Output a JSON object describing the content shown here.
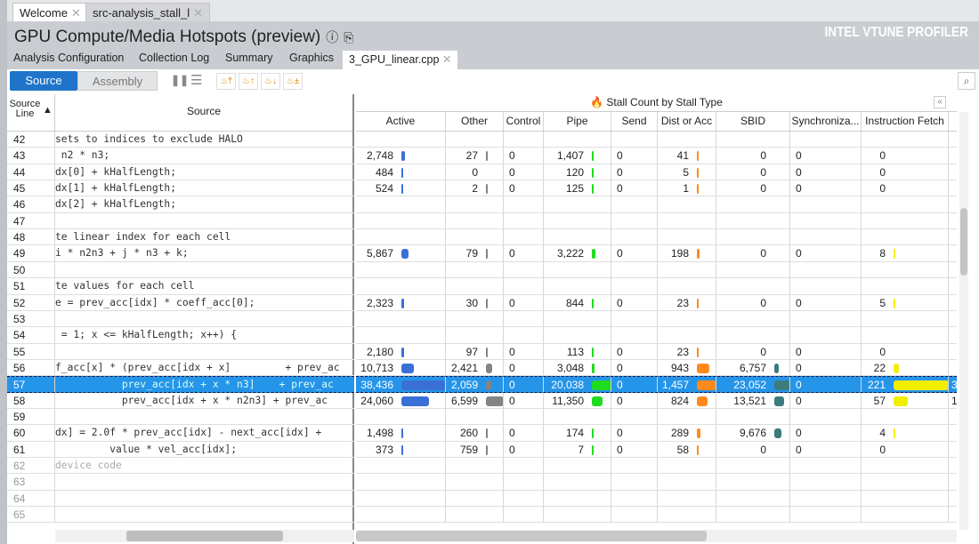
{
  "doc_tabs": [
    {
      "label": "Welcome"
    },
    {
      "label": "src-analysis_stall_l"
    }
  ],
  "title": "GPU Compute/Media Hotspots (preview)",
  "brand": "INTEL VTUNE PROFILER",
  "nav_tabs": [
    "Analysis Configuration",
    "Collection Log",
    "Summary",
    "Graphics",
    "3_GPU_linear.cpp"
  ],
  "toolbar": {
    "source": "Source",
    "assembly": "Assembly"
  },
  "left_headers": {
    "line": "Source Line",
    "source": "Source"
  },
  "group_header": "Stall Count by Stall Type",
  "columns": [
    "Active",
    "Other",
    "Control",
    "Pipe",
    "Send",
    "Dist or Acc",
    "SBID",
    "Synchroniza...",
    "Instruction Fetch"
  ],
  "bar_colors": {
    "0": "#3a70d6",
    "1": "#848484",
    "3": "#1edc1e",
    "5": "#ff8a1c",
    "6": "#3c7c7c",
    "8": "#f2ee00"
  },
  "rows": [
    {
      "line": "42",
      "src": "sets to indices to exclude HALO",
      "v": []
    },
    {
      "line": "43",
      "src": " n2 * n3;",
      "v": [
        "2,748",
        "27",
        "0",
        "1,407",
        "0",
        "41",
        "0",
        "0",
        "0"
      ]
    },
    {
      "line": "44",
      "src": "dx[0] + kHalfLength;",
      "v": [
        "484",
        "0",
        "0",
        "120",
        "0",
        "5",
        "0",
        "0",
        "0"
      ]
    },
    {
      "line": "45",
      "src": "dx[1] + kHalfLength;",
      "v": [
        "524",
        "2",
        "0",
        "125",
        "0",
        "1",
        "0",
        "0",
        "0"
      ]
    },
    {
      "line": "46",
      "src": "dx[2] + kHalfLength;",
      "v": []
    },
    {
      "line": "47",
      "src": "",
      "v": []
    },
    {
      "line": "48",
      "src": "te linear index for each cell",
      "v": []
    },
    {
      "line": "49",
      "src": "i * n2n3 + j * n3 + k;",
      "v": [
        "5,867",
        "79",
        "0",
        "3,222",
        "0",
        "198",
        "0",
        "0",
        "8"
      ]
    },
    {
      "line": "50",
      "src": "",
      "v": []
    },
    {
      "line": "51",
      "src": "te values for each cell",
      "v": []
    },
    {
      "line": "52",
      "src": "e = prev_acc[idx] * coeff_acc[0];",
      "v": [
        "2,323",
        "30",
        "0",
        "844",
        "0",
        "23",
        "0",
        "0",
        "5"
      ]
    },
    {
      "line": "53",
      "src": "",
      "v": []
    },
    {
      "line": "54",
      "src": " = 1; x <= kHalfLength; x++) {",
      "v": []
    },
    {
      "line": "55",
      "src": "",
      "v": [
        "2,180",
        "97",
        "0",
        "113",
        "0",
        "23",
        "0",
        "0",
        "0"
      ]
    },
    {
      "line": "56",
      "src": "f_acc[x] * (prev_acc[idx + x]         + prev_ac",
      "v": [
        "10,713",
        "2,421",
        "0",
        "3,048",
        "0",
        "943",
        "6,757",
        "0",
        "22"
      ]
    },
    {
      "line": "57",
      "src": "           prev_acc[idx + x * n3]    + prev_ac",
      "v": [
        "38,436",
        "2,059",
        "0",
        "20,038",
        "0",
        "1,457",
        "23,052",
        "0",
        "221"
      ],
      "extra": "3",
      "selected": true
    },
    {
      "line": "58",
      "src": "           prev_acc[idx + x * n2n3] + prev_ac",
      "v": [
        "24,060",
        "6,599",
        "0",
        "11,350",
        "0",
        "824",
        "13,521",
        "0",
        "57"
      ],
      "extra": "1"
    },
    {
      "line": "59",
      "src": "",
      "v": []
    },
    {
      "line": "60",
      "src": "dx] = 2.0f * prev_acc[idx] - next_acc[idx] +",
      "v": [
        "1,498",
        "260",
        "0",
        "174",
        "0",
        "289",
        "9,676",
        "0",
        "4"
      ]
    },
    {
      "line": "61",
      "src": "         value * vel_acc[idx];",
      "v": [
        "373",
        "759",
        "0",
        "7",
        "0",
        "58",
        "0",
        "0",
        "0"
      ]
    },
    {
      "line": "62",
      "src": "device code",
      "v": [],
      "dim": true
    },
    {
      "line": "63",
      "src": "",
      "v": [],
      "dim": true
    },
    {
      "line": "64",
      "src": "",
      "v": [],
      "dim": true
    },
    {
      "line": "65",
      "src": "",
      "v": [],
      "dim": true
    }
  ]
}
